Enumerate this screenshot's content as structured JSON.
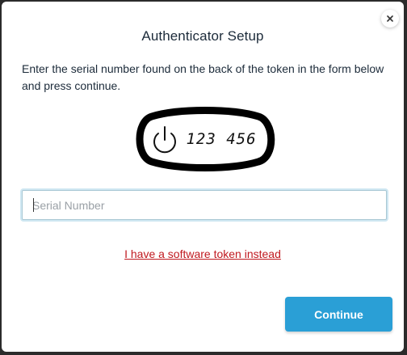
{
  "dialog": {
    "title": "Authenticator Setup",
    "instructions": "Enter the serial number found on the back of the token in the form below and press continue.",
    "close_icon": "close-icon"
  },
  "token": {
    "display_code": "123 456",
    "power_icon": "power-icon"
  },
  "form": {
    "serial_placeholder": "Serial Number",
    "serial_value": ""
  },
  "links": {
    "software_token": "I have a software token instead"
  },
  "actions": {
    "continue_label": "Continue"
  },
  "colors": {
    "primary_button": "#2a9fd6",
    "link": "#c0191f",
    "text": "#1c2b3a"
  }
}
